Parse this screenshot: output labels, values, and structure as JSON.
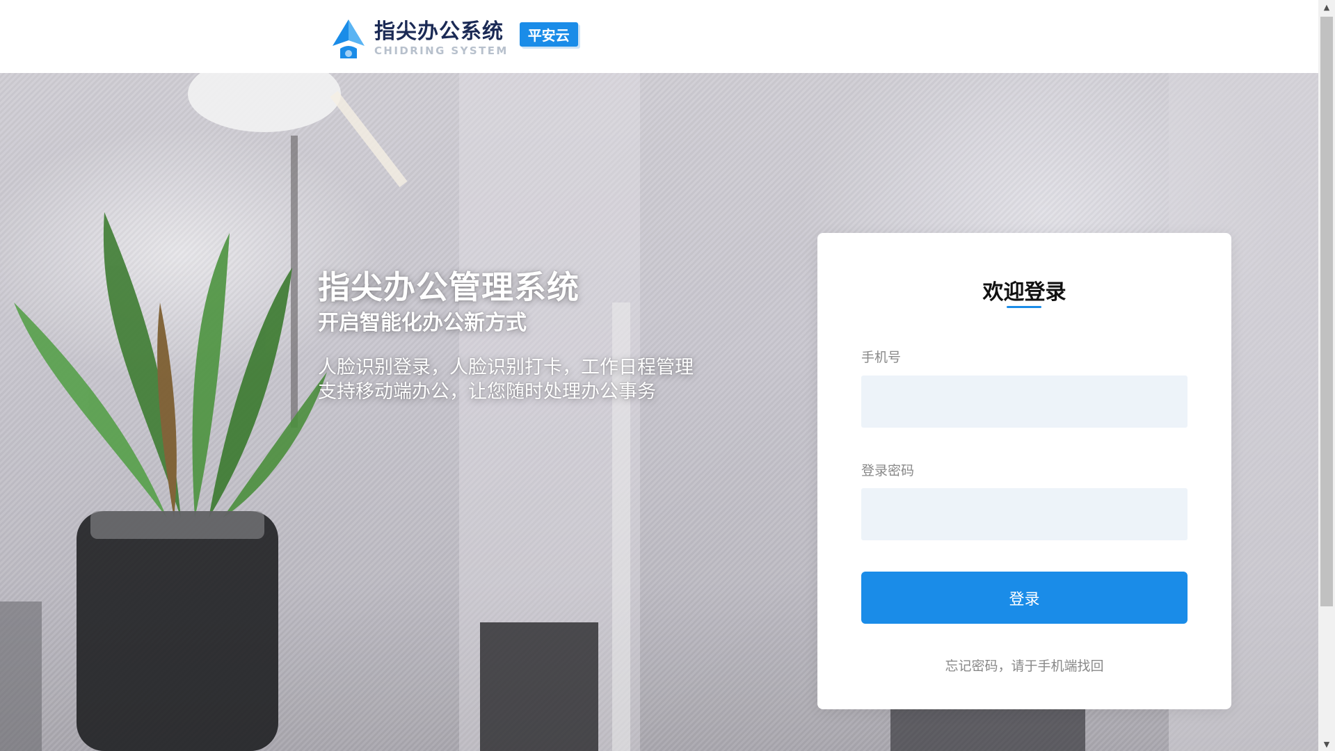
{
  "header": {
    "logo_title": "指尖办公系统",
    "logo_subtitle": "CHIDRING SYSTEM",
    "logo_badge": "平安云"
  },
  "hero": {
    "title": "指尖办公管理系统",
    "subtitle": "开启智能化办公新方式",
    "desc_line1": "人脸识别登录，人脸识别打卡，工作日程管理",
    "desc_line2": "支持移动端办公，让您随时处理办公事务"
  },
  "login": {
    "title": "欢迎登录",
    "phone_label": "手机号",
    "phone_value": "",
    "password_label": "登录密码",
    "password_value": "",
    "submit_label": "登录",
    "forgot_text": "忘记密码，请于手机端找回"
  },
  "colors": {
    "accent": "#1a8ce8",
    "input_bg": "#edf3f9",
    "logo_text": "#1b2a55"
  },
  "icons": {
    "logo": "pen-nib-logo-icon",
    "scroll_up": "triangle-up-icon",
    "scroll_down": "triangle-down-icon"
  }
}
